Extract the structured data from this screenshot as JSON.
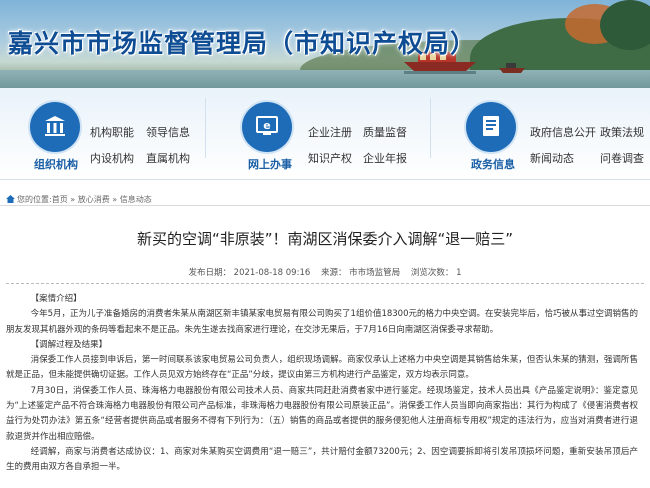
{
  "header": {
    "site_title": "嘉兴市市场监督管理局（市知识产权局）"
  },
  "nav": {
    "groups": [
      {
        "category": "组织机构",
        "icon": "building-icon",
        "links": [
          "机构职能",
          "领导信息",
          "内设机构",
          "直属机构"
        ]
      },
      {
        "category": "网上办事",
        "icon": "browser-e-icon",
        "links": [
          "企业注册",
          "质量监督",
          "知识产权",
          "企业年报"
        ]
      },
      {
        "category": "政务信息",
        "icon": "document-icon",
        "links": [
          "政府信息公开",
          "政策法规",
          "新闻动态",
          "问卷调查"
        ]
      }
    ]
  },
  "breadcrumb": {
    "home": "您的位置:首页",
    "sep1": "»",
    "section": "放心消费",
    "sep2": "»",
    "current": "信息动态"
  },
  "article": {
    "title": "新买的空调“非原装”！南湖区消保委介入调解“退一赔三”",
    "meta": {
      "date": "发布日期： 2021-08-18 09:16",
      "source": "来源： 市市场监管局",
      "views": "浏览次数： 1"
    },
    "paragraphs": [
      "【案情介绍】",
      "今年5月，正为儿子准备婚房的消费者朱某从南湖区新丰镇某家电贸易有限公司购买了1组价值18300元的格力中央空调。在安装完毕后，恰巧被从事过空调销售的朋友发现其机器外观的条码等看起来不是正品。朱先生遂去找商家进行理论，在交涉无果后，于7月16日向南湖区消保委寻求帮助。",
      "【调解过程及结果】",
      "消保委工作人员接到申诉后，第一时间联系该家电贸易公司负责人，组织现场调解。商家仅承认上述格力中央空调是其销售给朱某，但否认朱某的猜测，强调所售就是正品，但未能提供确切证据。工作人员见双方始终存在“正品”分歧，提议由第三方机构进行产品鉴定，双方均表示同意。",
      "7月30日，消保委工作人员、珠海格力电器股份有限公司技术人员、商家共同赶赴消费者家中进行鉴定。经现场鉴定，技术人员出具《产品鉴定说明》：鉴定意见为“上述鉴定产品不符合珠海格力电器股份有限公司产品标准，非珠海格力电器股份有限公司原装正品”。消保委工作人员当即向商家指出：其行为构成了《侵害消费者权益行为处罚办法》第五条“经营者提供商品或者服务不得有下列行为：（五）销售的商品或者提供的服务侵犯他人注册商标专用权”规定的违法行为，应当对消费者进行退款退货并作出相应赔偿。",
      "经调解，商家与消费者达成协议：1、商家对朱某购买空调费用“退一赔三”，共计赔付金额73200元；2、因空调要拆卸将引发吊顶损坏问题，重新安装吊顶后产生的费用由双方各自承担一半。"
    ]
  }
}
